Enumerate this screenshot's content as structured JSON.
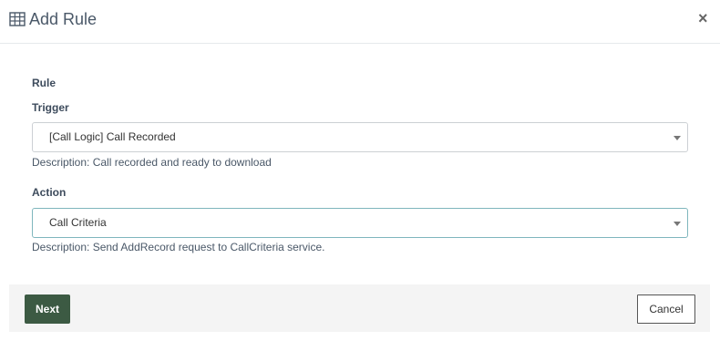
{
  "header": {
    "title": "Add Rule",
    "title_icon": "table-icon",
    "close_label": "×"
  },
  "form": {
    "rule_label": "Rule",
    "trigger": {
      "label": "Trigger",
      "value": "[Call Logic] Call Recorded",
      "description": "Description: Call recorded and ready to download"
    },
    "action": {
      "label": "Action",
      "value": "Call Criteria",
      "description": "Description: Send AddRecord request to CallCriteria service."
    }
  },
  "footer": {
    "next_label": "Next",
    "cancel_label": "Cancel"
  },
  "colors": {
    "primary_button": "#3c5a43",
    "focus_border": "#7fb6bd"
  }
}
